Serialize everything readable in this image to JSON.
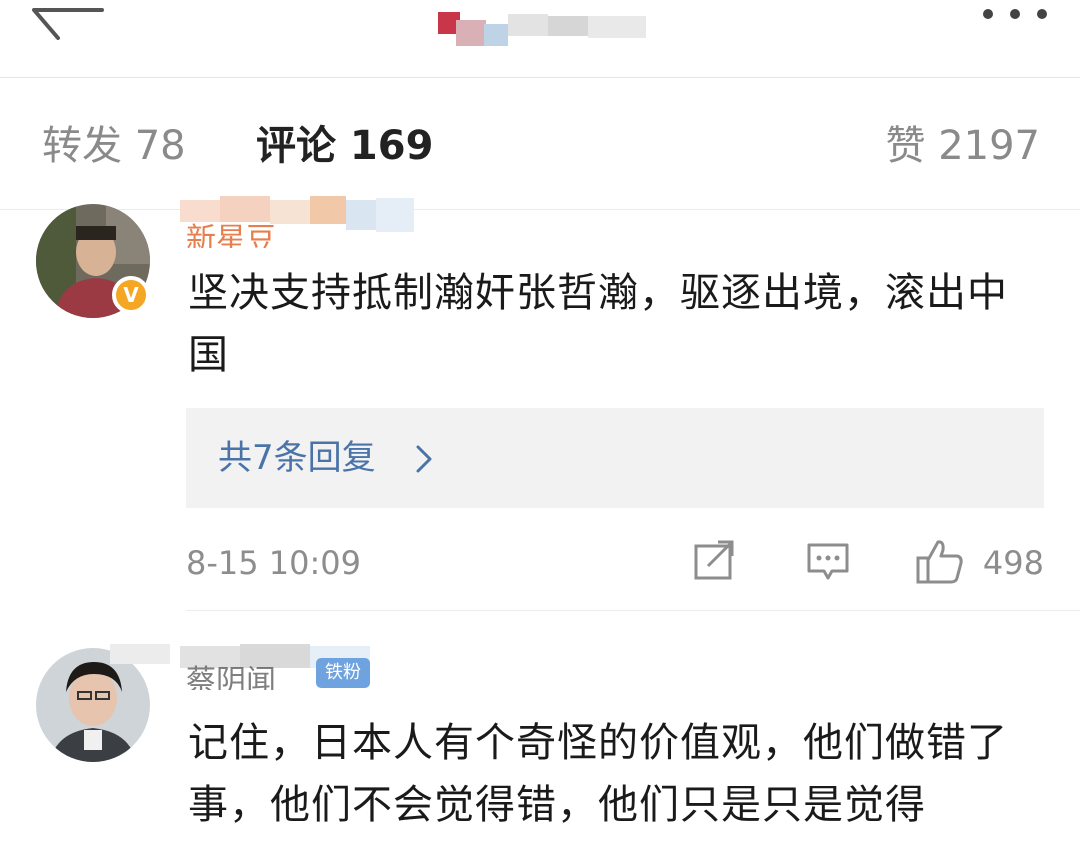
{
  "header": {
    "back_icon": "back-arrow-icon",
    "more_icon": "more-dots-icon"
  },
  "tabs": {
    "repost": "转发 78",
    "comment": "评论 169",
    "like": "赞 2197"
  },
  "comments": [
    {
      "username": "新星豆",
      "avatar_icon": "user-avatar",
      "verified_badge": "V",
      "text": "坚决支持抵制瀚奸张哲瀚，驱逐出境，滚出中国",
      "reply_link": "共7条回复",
      "timestamp": "8-15 10:09",
      "like_count": "498"
    },
    {
      "username": "蔡阴闻",
      "level_badge": "铁粉",
      "avatar_icon": "user-avatar",
      "text": "记住，日本人有个奇怪的价值观，他们做错了事，他们不会觉得错，他们只是只是觉得"
    }
  ],
  "colors": {
    "accent_link": "#4a74a8",
    "username": "#e5713b",
    "badge_gold": "#f5a623",
    "badge_blue": "#6fa3e0",
    "muted": "#8d8d8d"
  }
}
